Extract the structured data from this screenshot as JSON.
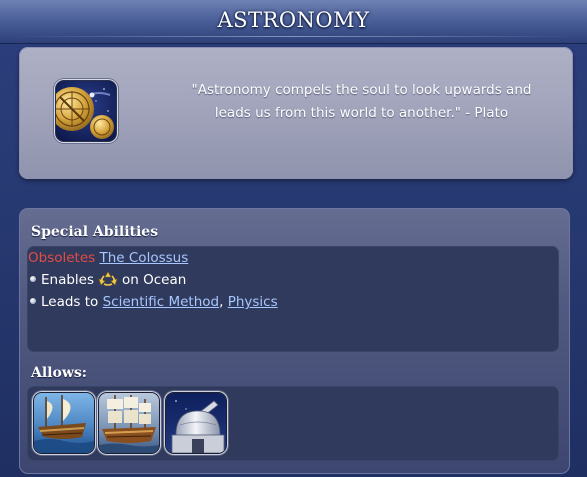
{
  "header": {
    "title": "ASTRONOMY"
  },
  "quote": {
    "line1": "\"Astronomy compels the soul to look upwards and",
    "line2": "leads us from this world to another.\" - Plato",
    "tech_icon": "astronomy-astrolabe-icon"
  },
  "special_abilities": {
    "heading": "Special Abilities",
    "obsoletes_label": "Obsoletes",
    "obsoletes_link": "The Colossus",
    "enables_prefix": "Enables",
    "enables_icon": "trade-route-icon",
    "enables_suffix": "on Ocean",
    "leads_to_prefix": "Leads to",
    "leads_to_links": [
      "Scientific Method",
      "Physics"
    ],
    "separator": ","
  },
  "allows": {
    "heading": "Allows:",
    "items": [
      {
        "icon": "galleon-ship-icon"
      },
      {
        "icon": "frigate-ship-icon"
      },
      {
        "icon": "observatory-icon"
      }
    ]
  },
  "colors": {
    "obsolete_text": "#e54b45",
    "link_text": "#a8c6ff",
    "background": "#26386f"
  }
}
